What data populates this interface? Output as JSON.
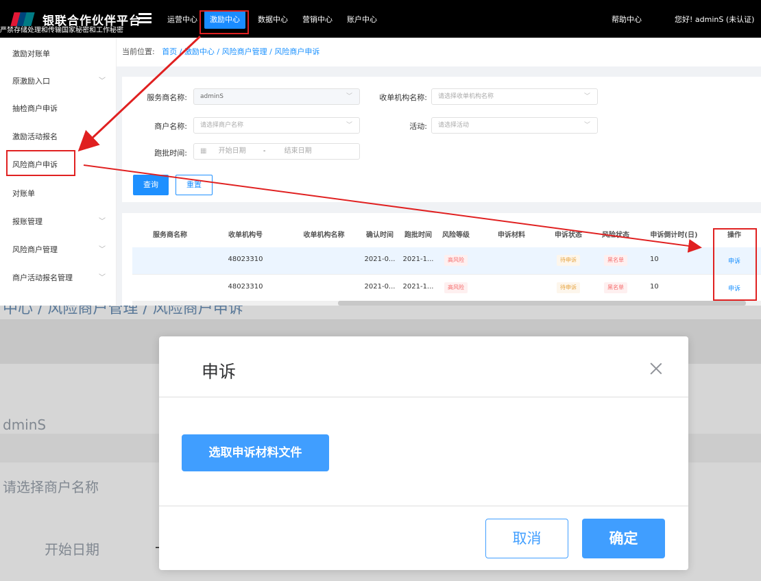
{
  "header": {
    "brand": "银联合作伙伴平台",
    "brand_sub": "严禁存储处理和传输国家秘密和工作秘密",
    "nav": [
      "运营中心",
      "激励中心",
      "数据中心",
      "营销中心",
      "账户中心"
    ],
    "help": "帮助中心",
    "greeting": "您好! adminS (未认证)"
  },
  "sidebar": {
    "items": [
      {
        "label": "激励对账单"
      },
      {
        "label": "原激励入口"
      },
      {
        "label": "抽检商户申诉"
      },
      {
        "label": "激励活动报名"
      },
      {
        "label": "风险商户申诉"
      },
      {
        "label": "对账单"
      },
      {
        "label": "报账管理"
      },
      {
        "label": "风险商户管理"
      },
      {
        "label": "商户活动报名管理"
      }
    ]
  },
  "breadcrumb": {
    "prefix": "当前位置:",
    "home": "首页",
    "sep": "/",
    "path": "激励中心 / 风险商户管理 / 风险商户申诉"
  },
  "filters": {
    "service_label": "服务商名称:",
    "service_value": "adminS",
    "acquirer_label": "收单机构名称:",
    "acquirer_placeholder": "请选择收单机构名称",
    "merchant_label": "商户名称:",
    "merchant_placeholder": "请选择商户名称",
    "activity_label": "活动:",
    "activity_placeholder": "请选择活动",
    "batch_label": "跑批时间:",
    "start_placeholder": "开始日期",
    "range_sep": "-",
    "end_placeholder": "结束日期",
    "search_button": "查询",
    "reset_button": "重置"
  },
  "table": {
    "columns": [
      "服务商名称",
      "收单机构号",
      "收单机构名称",
      "确认时间",
      "跑批时间",
      "风险等级",
      "申诉材料",
      "申诉状态",
      "风险状态",
      "申诉倒计时(日)",
      "操作"
    ],
    "rows": [
      {
        "service": "",
        "acq_no": "48023310",
        "acq_name": "",
        "confirm": "2021-0...",
        "batch": "2021-1...",
        "risk": "高风险",
        "material": "",
        "status": "待申诉",
        "risk_status": "黑名单",
        "countdown": "10",
        "op": "申诉"
      },
      {
        "service": "",
        "acq_no": "48023310",
        "acq_name": "",
        "confirm": "2021-0...",
        "batch": "2021-1...",
        "risk": "高风险",
        "material": "",
        "status": "待申诉",
        "risk_status": "黑名单",
        "countdown": "10",
        "op": "申诉"
      }
    ]
  },
  "background2": {
    "crumb_fragment": "中心 / 风险商户管理 / 风险商户申诉",
    "service_fragment": "dminS",
    "merchant_fragment": "请选择商户名称",
    "date_fragment": "开始日期",
    "dash": "-"
  },
  "modal": {
    "title": "申诉",
    "upload_button": "选取申诉材料文件",
    "cancel_button": "取消",
    "ok_button": "确定"
  },
  "colors": {
    "accent": "#1e90ff",
    "annotation": "#e02020",
    "topbar": "#000000"
  }
}
